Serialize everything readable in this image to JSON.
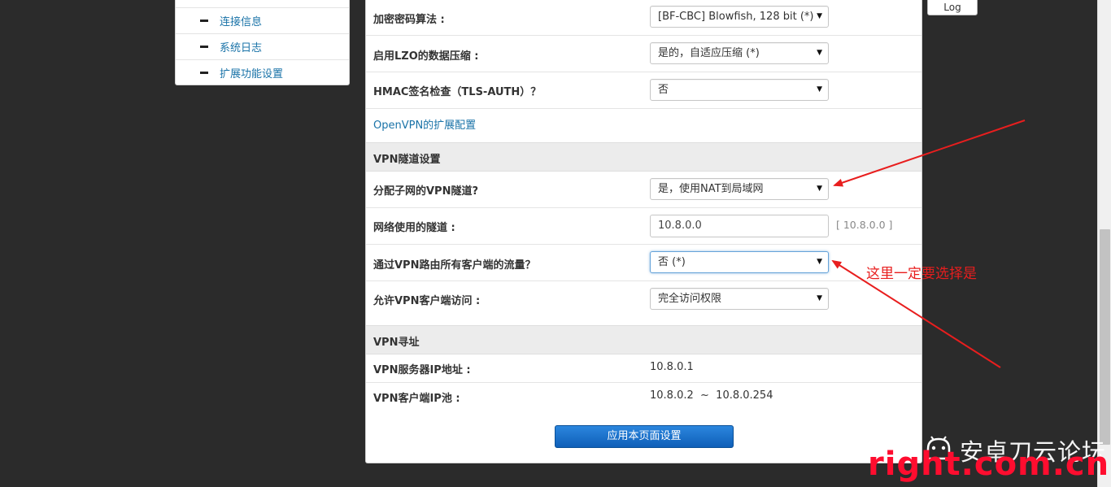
{
  "sidebar": {
    "items": [
      {
        "label": "连接信息"
      },
      {
        "label": "系统日志"
      },
      {
        "label": "扩展功能设置"
      }
    ]
  },
  "header": {
    "log_button": "Log"
  },
  "openvpn": {
    "cipher": {
      "label": "加密密码算法 :",
      "value": "[BF-CBC] Blowfish, 128 bit (*)"
    },
    "lzo": {
      "label": "启用LZO的数据压缩 :",
      "value": "是的，自适应压缩 (*)"
    },
    "hmac": {
      "label": "HMAC签名检查（TLS-AUTH）？",
      "value": "否"
    },
    "ext_link": "OpenVPN的扩展配置"
  },
  "tunnel": {
    "section_title": "VPN隧道设置",
    "subnet": {
      "label": "分配子网的VPN隧道?",
      "value": "是，使用NAT到局域网"
    },
    "network": {
      "label": "网络使用的隧道 :",
      "value": "10.8.0.0",
      "hint": "[ 10.8.0.0 ]"
    },
    "route_all": {
      "label": "通过VPN路由所有客户端的流量？",
      "value": "否 (*)"
    },
    "access": {
      "label": "允许VPN客户端访问 :",
      "value": "完全访问权限"
    }
  },
  "addressing": {
    "section_title": "VPN寻址",
    "server_ip": {
      "label": "VPN服务器IP地址 :",
      "value": "10.8.0.1"
    },
    "client_pool": {
      "label": "VPN客户端IP池 :",
      "value": "10.8.0.2  ~  10.8.0.254"
    }
  },
  "apply_button": "应用本页面设置",
  "annotation": {
    "note": "这里一定要选择是",
    "color": "#e81e1e"
  },
  "watermark": {
    "cn": "安卓刀云论坛",
    "en": "right.com.cn"
  }
}
